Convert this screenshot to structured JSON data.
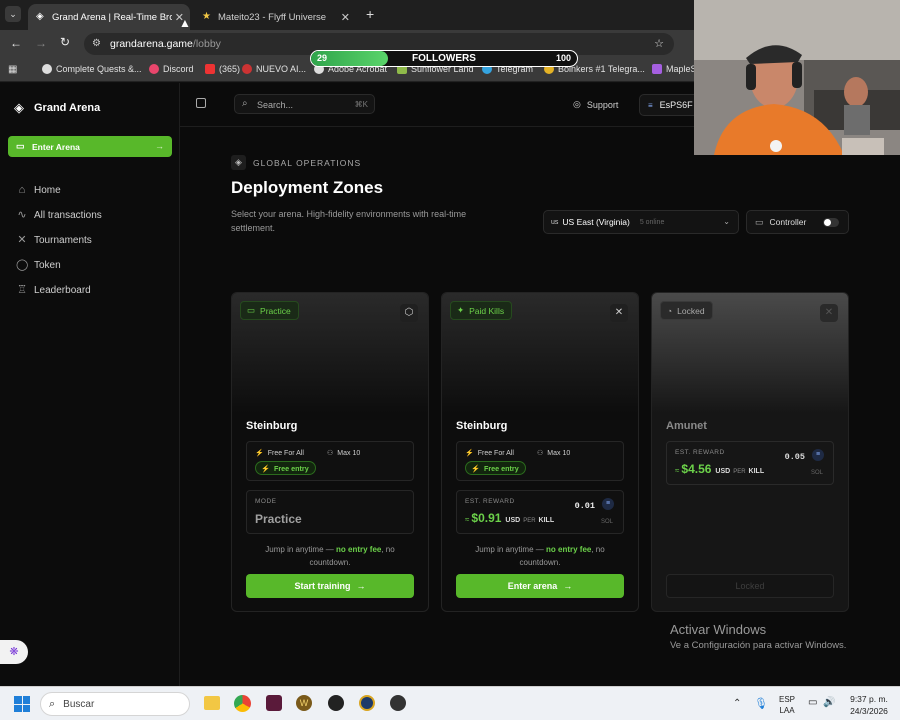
{
  "browser": {
    "tabs": [
      {
        "title": "Grand Arena | Real-Time Brows",
        "active": true
      },
      {
        "title": "Mateito23 - Flyff Universe",
        "active": false
      }
    ],
    "url_host": "grandarena.game",
    "url_path": "/lobby",
    "bookmarks": [
      "Complete Quests &...",
      "Discord",
      "(365)",
      "NUEVO AI...",
      "Adobe Acrobat",
      "Sunflower Land",
      "Telegram",
      "Boinkers #1 Telegra...",
      "MapleS"
    ]
  },
  "overlay": {
    "followers_label": "FOLLOWERS",
    "followers_current": "29",
    "followers_goal": "100",
    "followers_progress": 0.29
  },
  "sidebar": {
    "brand": "Grand Arena",
    "enter_arena": "Enter Arena",
    "items": [
      {
        "label": "Home",
        "icon": "home-icon"
      },
      {
        "label": "All transactions",
        "icon": "activity-icon"
      },
      {
        "label": "Tournaments",
        "icon": "swords-icon"
      },
      {
        "label": "Token",
        "icon": "coin-icon"
      },
      {
        "label": "Leaderboard",
        "icon": "trophy-icon"
      }
    ]
  },
  "topbar": {
    "search_placeholder": "Search...",
    "search_shortcut": "⌘K",
    "support": "Support",
    "wallet": "EsPS6F"
  },
  "header": {
    "eyebrow": "GLOBAL OPERATIONS",
    "title": "Deployment Zones",
    "subtitle": "Select your arena. High-fidelity environments with real-time settlement.",
    "region": "US East (Virginia)",
    "region_code": "us",
    "region_status": "5 online",
    "controller_label": "Controller"
  },
  "cards": [
    {
      "badge": "Practice",
      "title": "Steinburg",
      "mode": "Free For All",
      "max": "Max 10",
      "entry": "Free entry",
      "box_label": "MODE",
      "box_value": "Practice",
      "desc_pre": "Jump in anytime —",
      "desc_bold": "no entry fee",
      "desc_post": ", no countdown.",
      "button": "Start training"
    },
    {
      "badge": "Paid Kills",
      "title": "Steinburg",
      "mode": "Free For All",
      "max": "Max 10",
      "entry": "Free entry",
      "box_label": "EST. REWARD",
      "token_amount": "0.01",
      "token_unit": "SOL",
      "reward": "$0.91",
      "reward_unit": "USD",
      "reward_per": "PER",
      "reward_kill": "KILL",
      "desc_pre": "Jump in anytime —",
      "desc_bold": "no entry fee",
      "desc_post": ", no countdown.",
      "button": "Enter arena"
    },
    {
      "badge": "Locked",
      "title": "Amunet",
      "box_label": "EST. REWARD",
      "token_amount": "0.05",
      "token_unit": "SOL",
      "reward": "$4.56",
      "reward_unit": "USD",
      "reward_per": "PER",
      "reward_kill": "KILL",
      "button": "Locked"
    }
  ],
  "windows": {
    "watermark_title": "Activar Windows",
    "watermark_sub": "Ve a Configuración para activar Windows.",
    "search": "Buscar",
    "lang": "ESP",
    "lang2": "LAA",
    "time": "9:37 p. m.",
    "date": "24/3/2026"
  },
  "colors": {
    "accent": "#58b82a",
    "accent_text": "#6cd24a",
    "background": "#0b0b0b"
  }
}
